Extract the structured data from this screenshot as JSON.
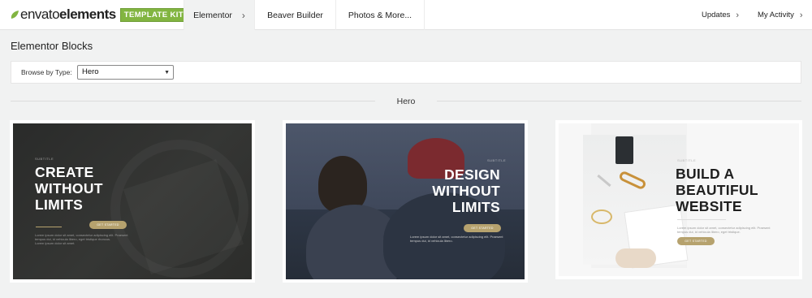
{
  "nav": {
    "logo_word1": "envato",
    "logo_word2": "elements",
    "logo_badge": "TEMPLATE KITS",
    "tabs": [
      {
        "label": "Elementor",
        "active": true,
        "chevron": "›"
      },
      {
        "label": "Beaver Builder",
        "active": false
      },
      {
        "label": "Photos & More...",
        "active": false
      }
    ],
    "right_links": [
      {
        "label": "Updates",
        "chevron": "›"
      },
      {
        "label": "My Activity",
        "chevron": "›"
      }
    ]
  },
  "page": {
    "title": "Elementor Blocks"
  },
  "filter": {
    "label": "Browse by Type:",
    "selected": "Hero",
    "caret": "▼"
  },
  "section": {
    "title": "Hero"
  },
  "cards": [
    {
      "overline": "SUBTITLE",
      "heading": [
        "CREATE",
        "WITHOUT",
        "LIMITS"
      ],
      "button": "GET STARTED",
      "para": [
        "Lorem ipsum dolor sit amet, consectetur adipiscing elit. Praesent",
        "tempus dui, id vehicula libero, eget tristique rhoncus.",
        "Lorem ipsum dolor sit amet."
      ]
    },
    {
      "overline": "SUBTITLE",
      "heading": [
        "DESIGN",
        "WITHOUT",
        "LIMITS"
      ],
      "button": "GET STARTED",
      "para": [
        "Lorem ipsum dolor sit amet, consectetur adipiscing elit. Praesent",
        "tempus dui, id vehicula libero."
      ]
    },
    {
      "overline": "SUBTITLE",
      "heading": [
        "BUILD A",
        "BEAUTIFUL",
        "WEBSITE"
      ],
      "button": "GET STARTED",
      "para": [
        "Lorem ipsum dolor sit amet, consectetur adipiscing elit. Praesent",
        "tempus dui, id vehicula libero, eget tristique."
      ]
    }
  ],
  "colors": {
    "brand_green": "#82b541",
    "accent_gold": "#b6a26e",
    "background": "#f1f2f2"
  }
}
